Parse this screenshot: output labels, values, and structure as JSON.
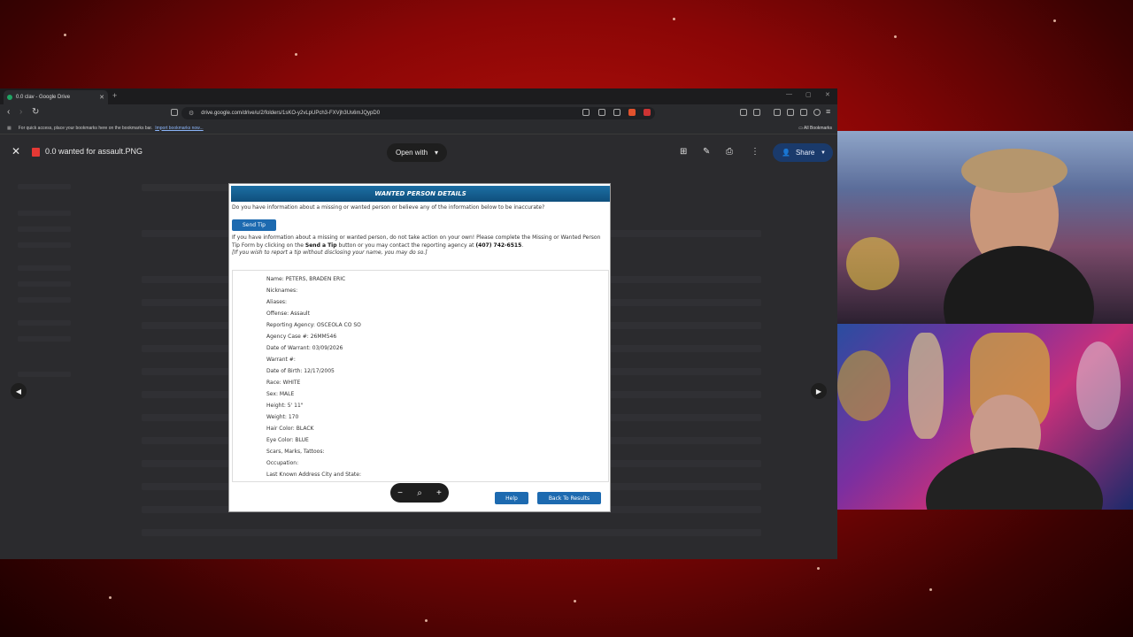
{
  "browser": {
    "tab_title": "0.0 clav - Google Drive",
    "url": "drive.google.com/drive/u/2/folders/1sKO-y2vLpUPch3-FXVjh3Us6mJQypD0",
    "bookmarks_hint": "For quick access, place your bookmarks here on the bookmarks bar.",
    "import_link": "Import bookmarks now...",
    "all_bookmarks": "All Bookmarks"
  },
  "viewer": {
    "file_name": "0.0 wanted for assault.PNG",
    "open_with_label": "Open with",
    "share_label": "Share"
  },
  "record": {
    "header": "WANTED PERSON DETAILS",
    "question": "Do you have information about a missing or wanted person or believe any of the information below to be inaccurate?",
    "send_tip_label": "Send Tip",
    "tip_text_1": "If you have information about a missing or wanted person, do not take action on your own! Please complete the Missing or Wanted Person Tip Form by clicking on the",
    "tip_text_bold_1": "Send a Tip",
    "tip_text_2": "button or you may contact the reporting agency at",
    "tip_phone": "(407) 742-6515",
    "tip_text_3": ".",
    "tip_anon": "[If you wish to report a tip without disclosing your name, you may do so.]",
    "fields": [
      "Name: PETERS, BRADEN ERIC",
      "Nicknames:",
      "Aliases:",
      "Offense: Assault",
      "Reporting Agency: OSCEOLA CO SO",
      "Agency Case #: 26MM546",
      "Date of Warrant: 03/09/2026",
      "Warrant #:",
      "Date of Birth: 12/17/2005",
      "Race: WHITE",
      "Sex: MALE",
      "Height: 5' 11\"",
      "Weight: 170",
      "Hair Color: BLACK",
      "Eye Color: BLUE",
      "Scars, Marks, Tattoos:",
      "Occupation:",
      "Last Known Address City and State:"
    ],
    "help_label": "Help",
    "back_label": "Back To Results"
  },
  "colors": {
    "background": "#8a0606",
    "modal_header": "#1c6fa3",
    "button_blue": "#1d6ab0",
    "share_bg": "#1a3a6b"
  },
  "icons": [
    "back-icon",
    "forward-icon",
    "reload-icon",
    "close-icon",
    "add-folder-icon",
    "add-comment-icon",
    "print-icon",
    "more-icon",
    "share-people-icon",
    "zoom-out-icon",
    "zoom-icon",
    "zoom-in-icon",
    "prev-icon",
    "next-icon"
  ]
}
